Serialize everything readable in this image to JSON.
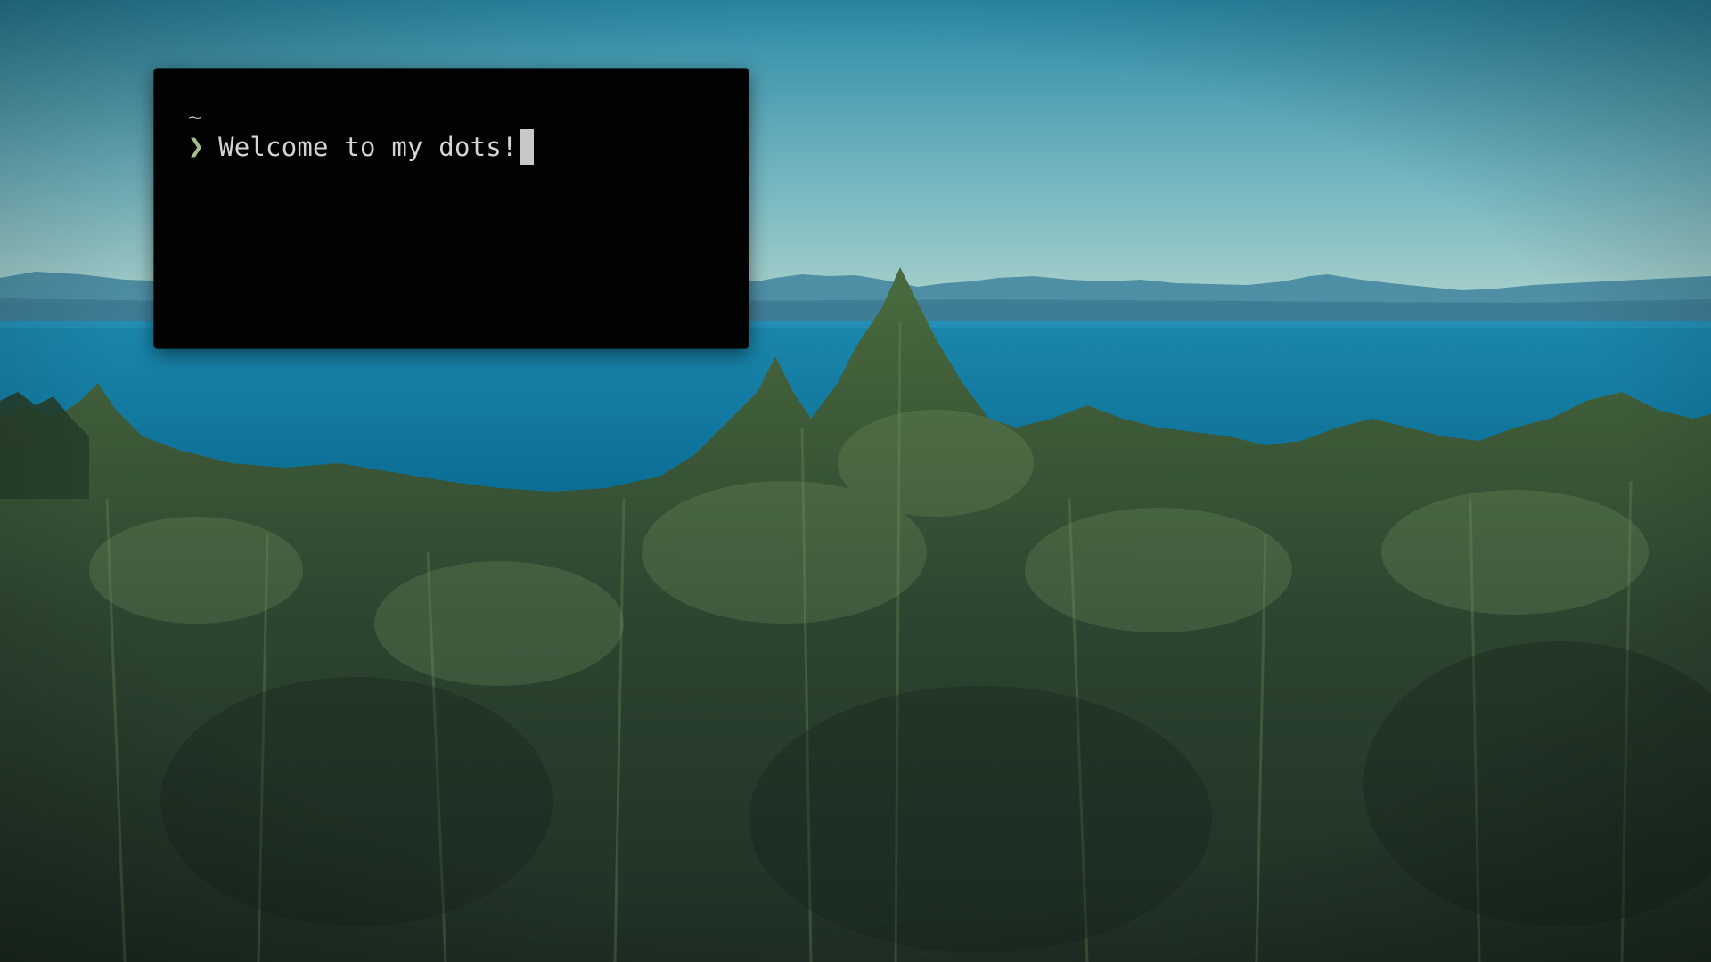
{
  "desktop": {
    "wallpaper_icon": "forest-sea-wallpaper",
    "colors": {
      "sky_top": "#2f8ea8",
      "sky_bottom": "#9cc9c6",
      "mountains": "#3d7f99",
      "sea": "#137ea3",
      "forest": "#2e4a2c"
    }
  },
  "terminal": {
    "background": "#020202",
    "cwd": "~",
    "prompt_symbol": "❯",
    "prompt_color": "#a3be8c",
    "command": "Welcome to my dots!",
    "cursor_icon": "block-cursor"
  }
}
